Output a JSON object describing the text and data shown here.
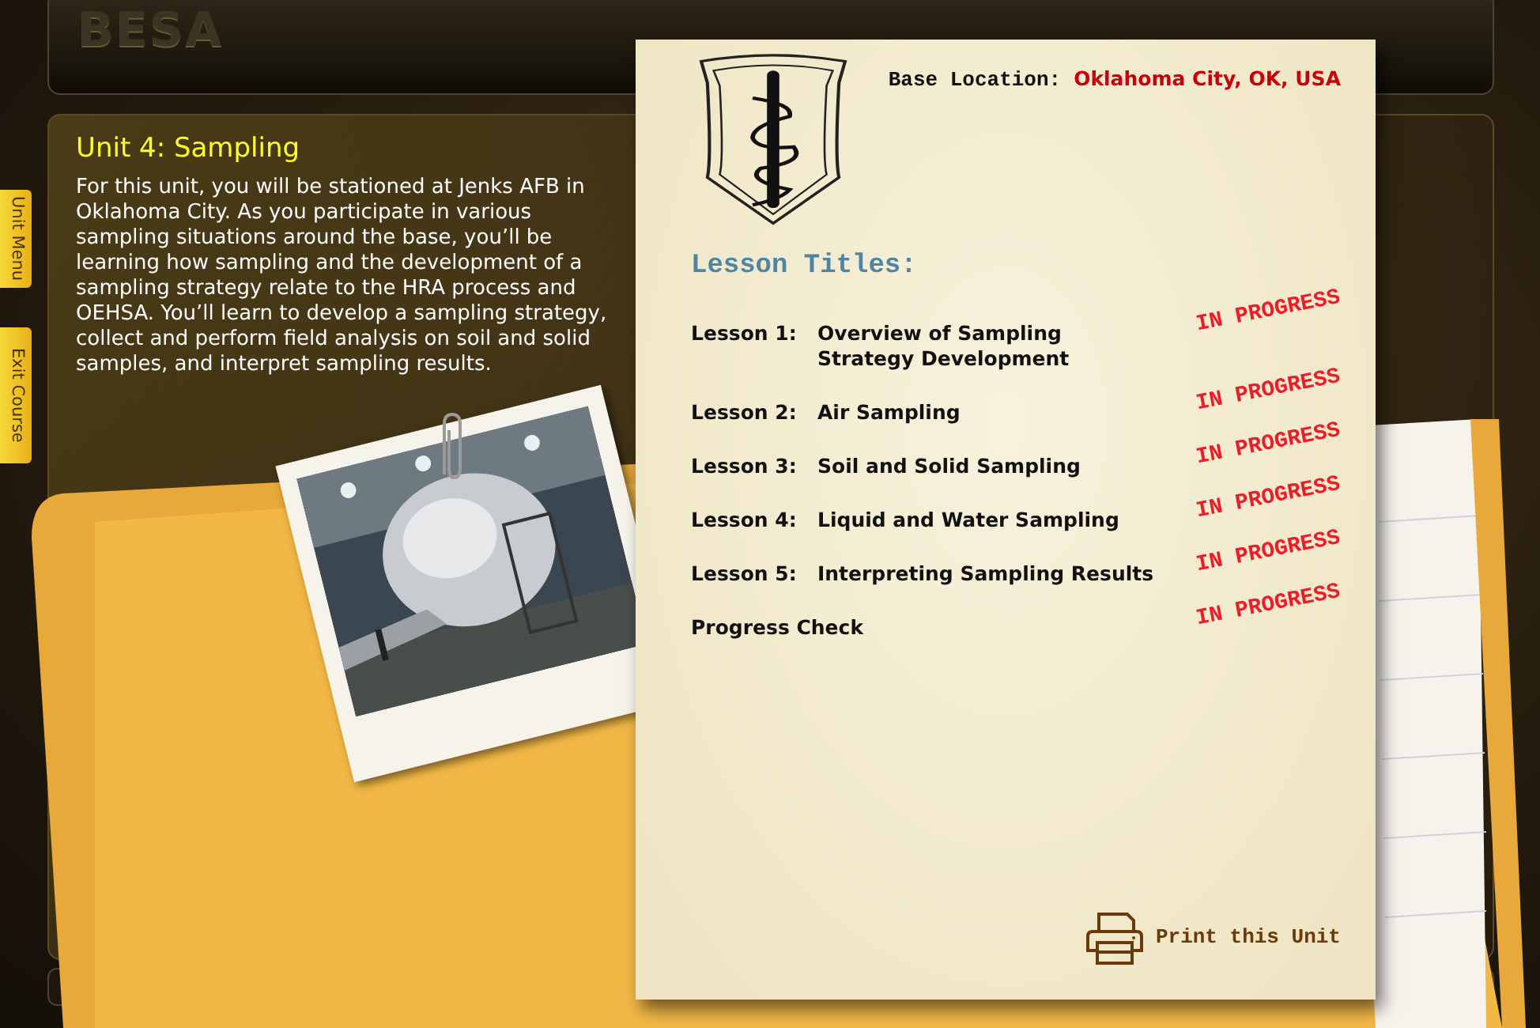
{
  "header": {
    "logo": "BESA"
  },
  "side_tabs": [
    {
      "label": "Unit Menu"
    },
    {
      "label": "Exit Course"
    }
  ],
  "unit": {
    "title": "Unit 4: Sampling",
    "description": "For this unit, you will be stationed at Jenks AFB in Oklahoma City. As you participate in various sampling situations around the base, you’ll be learning how sampling and the development of a sampling strategy relate to the HRA process and OEHSA. You’ll learn to develop a sampling strategy, collect and perform field analysis on soil and solid samples, and interpret sampling results."
  },
  "card": {
    "base_location_label": "Base Location:",
    "base_location": "Oklahoma City, OK, USA",
    "lessons_heading": "Lesson Titles:",
    "lessons": [
      {
        "number": "Lesson 1:",
        "title": "Overview of Sampling Strategy Development",
        "status": "IN PROGRESS"
      },
      {
        "number": "Lesson 2:",
        "title": "Air Sampling",
        "status": "IN PROGRESS"
      },
      {
        "number": "Lesson 3:",
        "title": "Soil and Solid Sampling",
        "status": "IN PROGRESS"
      },
      {
        "number": "Lesson 4:",
        "title": "Liquid and Water Sampling",
        "status": "IN PROGRESS"
      },
      {
        "number": "Lesson 5:",
        "title": "Interpreting Sampling Results",
        "status": "IN PROGRESS"
      },
      {
        "title": "Progress Check",
        "status": "IN PROGRESS"
      }
    ],
    "print_button": "Print this Unit"
  }
}
